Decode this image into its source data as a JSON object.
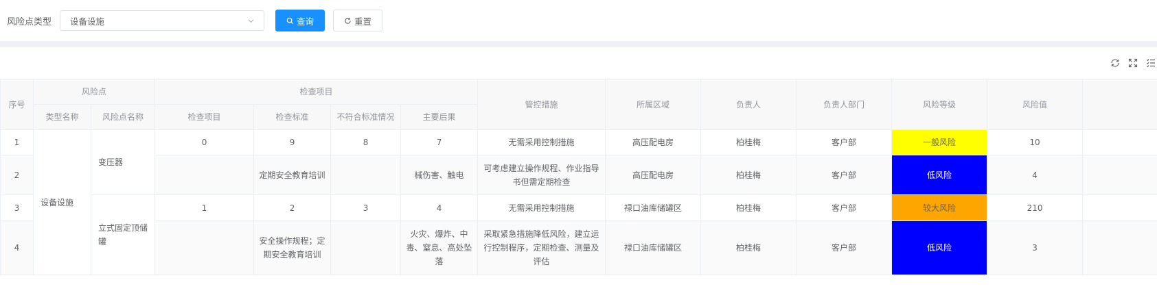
{
  "filter": {
    "label": "风险点类型",
    "select_value": "设备设施",
    "search_label": "查询",
    "reset_label": "重置"
  },
  "table": {
    "headers": {
      "index": "序号",
      "risk_point": "风险点",
      "type_name": "类型名称",
      "risk_point_name": "风险点名称",
      "inspection": "检查项目",
      "inspection_item": "检查项目",
      "inspection_standard": "检查标准",
      "nonconformity": "不符合标准情况",
      "main_consequence": "主要后果",
      "control_measures": "管控措施",
      "area": "所属区域",
      "person": "负责人",
      "department": "负责人部门",
      "risk_level": "风险等级",
      "risk_value": "风险值"
    },
    "type_name_merged": "设备设施",
    "risk_point_1": "变压器",
    "risk_point_2": "立式固定顶储罐",
    "rows": [
      {
        "index": "1",
        "item": "0",
        "standard": "9",
        "nonconf": "8",
        "consequence": "7",
        "measures": "无需采用控制措施",
        "area": "高压配电房",
        "person": "柏桂梅",
        "dept": "客户部",
        "level": "一般风险",
        "level_color": "#ffff00",
        "value": "10"
      },
      {
        "index": "2",
        "item": "",
        "standard": "定期安全教育培训",
        "nonconf": "",
        "consequence": "械伤害、触电",
        "measures": "可考虑建立操作规程、作业指导书但需定期检查",
        "area": "高压配电房",
        "person": "柏桂梅",
        "dept": "客户部",
        "level": "低风险",
        "level_color": "#0000ff",
        "value": "4"
      },
      {
        "index": "3",
        "item": "1",
        "standard": "2",
        "nonconf": "3",
        "consequence": "4",
        "measures": "无需采用控制措施",
        "area": "禄口油库储罐区",
        "person": "柏桂梅",
        "dept": "客户部",
        "level": "较大风险",
        "level_color": "#ffa500",
        "value": "210"
      },
      {
        "index": "4",
        "item": "",
        "standard": "安全操作规程；定期安全教育培训",
        "nonconf": "",
        "consequence": "火灾、爆炸、中毒、窒息、高处坠落",
        "measures": "采取紧急措施降低风险，建立运行控制程序，定期检查、测量及评估",
        "area": "禄口油库储罐区",
        "person": "柏桂梅",
        "dept": "客户部",
        "level": "低风险",
        "level_color": "#0000ff",
        "value": "3"
      }
    ]
  },
  "toolbar_icons": [
    "refresh-icon",
    "fullscreen-icon",
    "column-settings-icon"
  ]
}
